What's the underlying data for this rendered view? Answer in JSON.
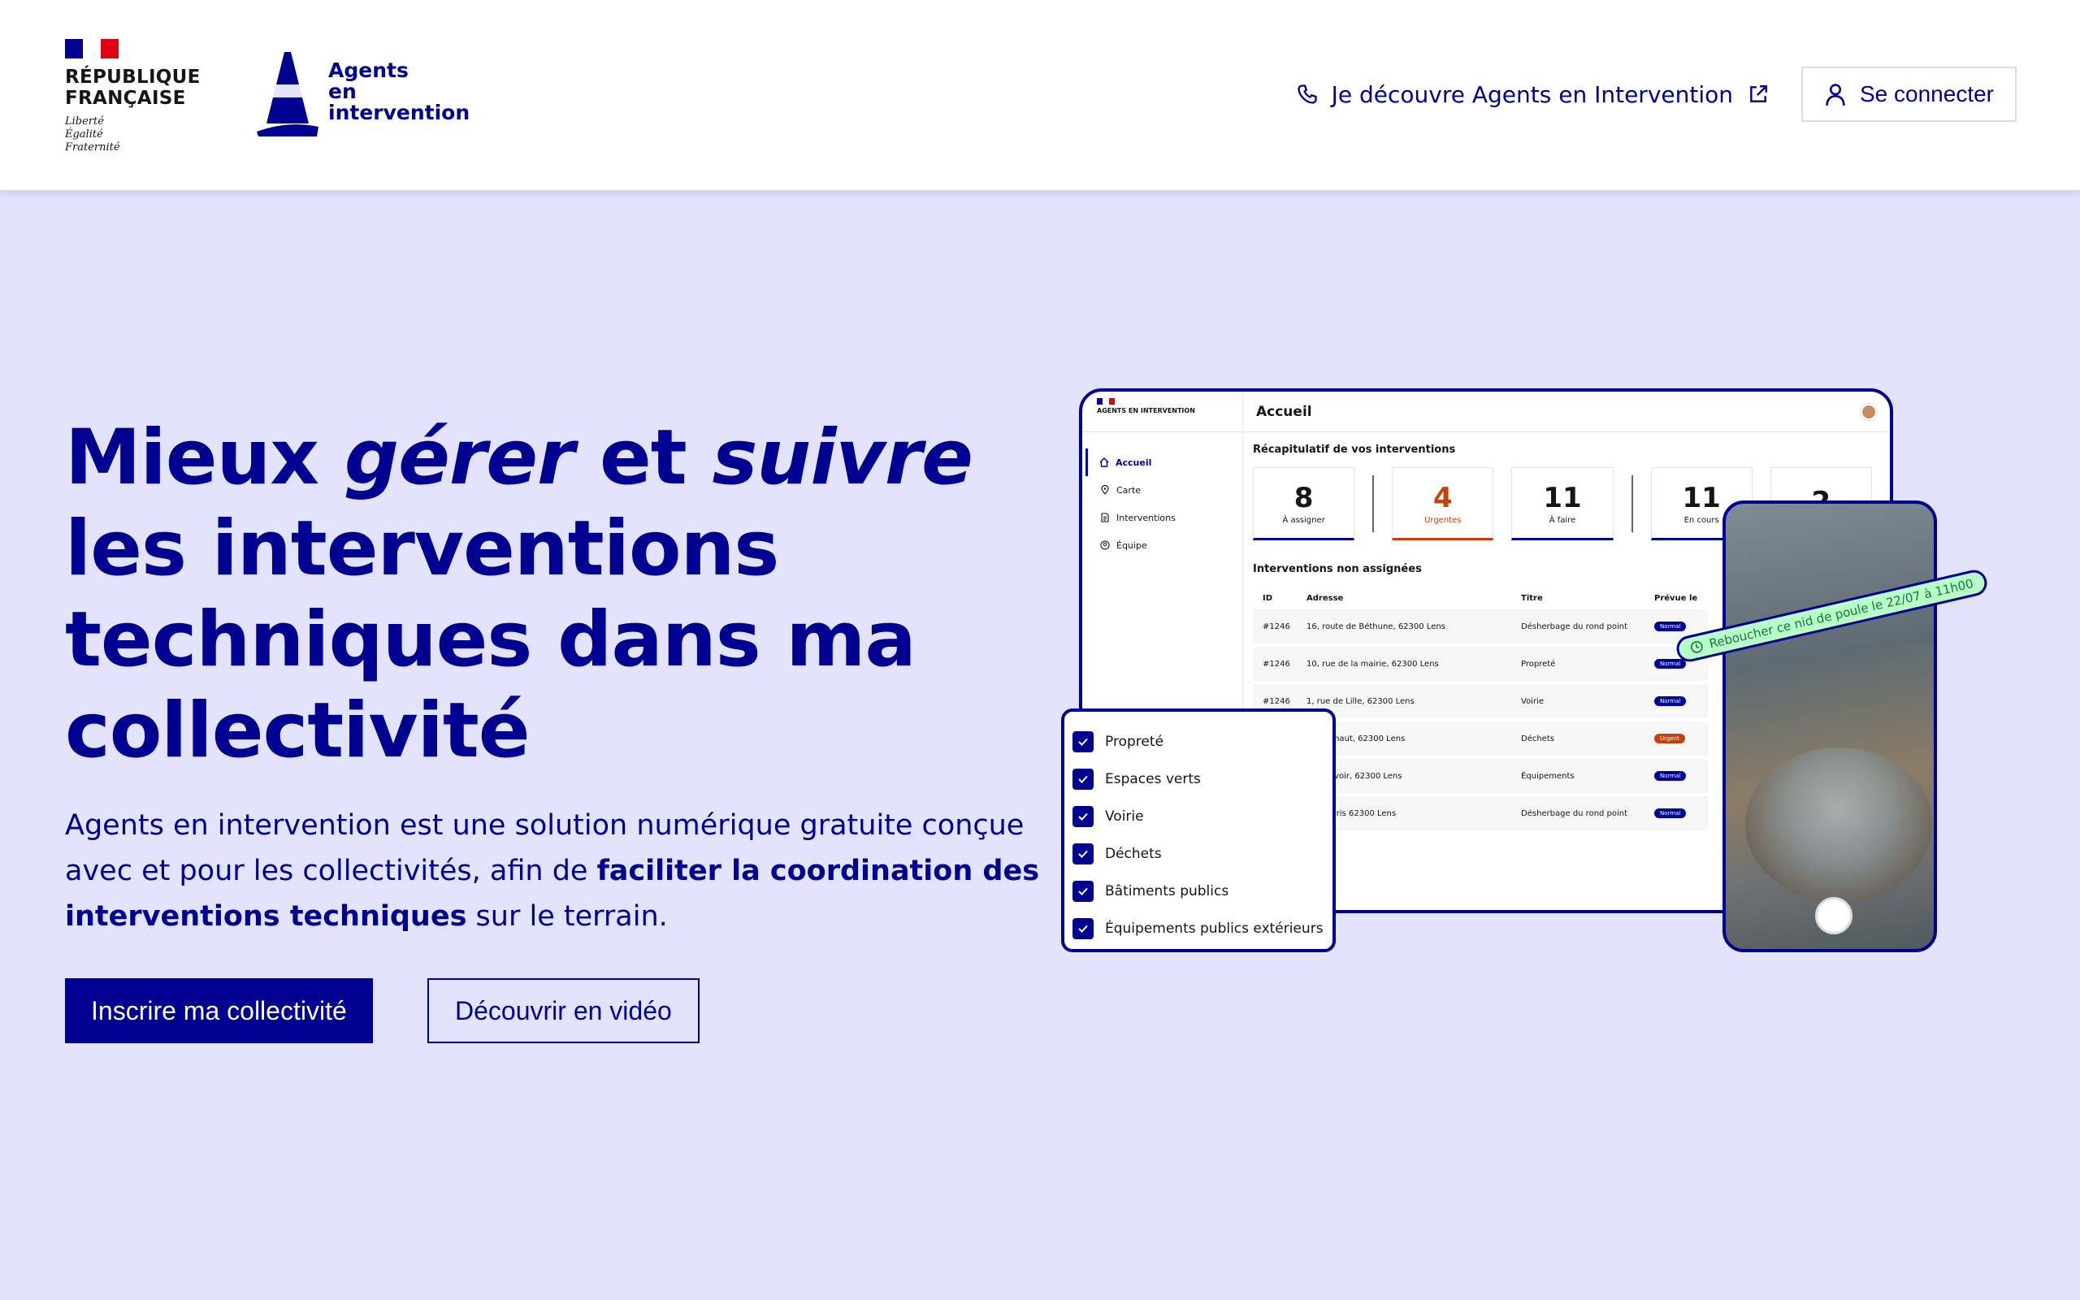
{
  "header": {
    "republic_line1": "RÉPUBLIQUE",
    "republic_line2": "FRANÇAISE",
    "motto": [
      "Liberté",
      "Égalité",
      "Fraternité"
    ],
    "brand_line1": "Agents",
    "brand_line2": "en",
    "brand_line3": "intervention",
    "discover_link": "Je découvre Agents en Intervention",
    "login_label": "Se connecter"
  },
  "hero": {
    "title_part1": "Mieux ",
    "title_em1": "gérer",
    "title_part2": " et ",
    "title_em2": "suivre",
    "title_part3": "les interventions techniques dans ma collectivité",
    "desc_part1": "Agents en intervention est une solution numérique gratuite conçue avec et pour les collectivités, afin de ",
    "desc_strong": "faciliter la coordination des interventions techniques",
    "desc_part2": " sur le terrain.",
    "primary_button": "Inscrire ma collectivité",
    "secondary_button": "Découvrir en vidéo"
  },
  "mockup": {
    "app_name": "AGENTS EN INTERVENTION",
    "menu": [
      "Accueil",
      "Carte",
      "Interventions",
      "Équipe"
    ],
    "page_title": "Accueil",
    "summary_title": "Récapitulatif de vos interventions",
    "cards": [
      {
        "num": "8",
        "label": "À assigner"
      },
      {
        "num": "4",
        "label": "Urgentes"
      },
      {
        "num": "11",
        "label": "À faire"
      },
      {
        "num": "11",
        "label": "En cours"
      },
      {
        "num": "2",
        "label": ""
      }
    ],
    "table_title": "Interventions non assignées",
    "columns": [
      "ID",
      "Adresse",
      "Titre",
      "Prévue le"
    ],
    "rows": [
      {
        "id": "#1246",
        "addr": "16, route de Béthune, 62300 Lens",
        "title": "Désherbage du rond point",
        "badge": "Normal"
      },
      {
        "id": "#1246",
        "addr": "10, rue de la mairie, 62300 Lens",
        "title": "Propreté",
        "badge": "Normal"
      },
      {
        "id": "#1246",
        "addr": "1, rue de Lille, 62300 Lens",
        "title": "Voirie",
        "badge": "Normal"
      },
      {
        "id": "",
        "addr": "e d'en haut, 62300 Lens",
        "title": "Déchets",
        "badge": "Urgent"
      },
      {
        "id": "",
        "addr": "e du lavoir, 62300 Lens",
        "title": "Équipements",
        "badge": "Normal"
      },
      {
        "id": "",
        "addr": "e de Paris 62300 Lens",
        "title": "Désherbage du rond point",
        "badge": "Normal"
      }
    ],
    "filters": [
      "Propreté",
      "Espaces verts",
      "Voirie",
      "Déchets",
      "Bâtiments publics",
      "Équipements publics extérieurs"
    ],
    "photo_tag": "Reboucher ce nid de poule le 22/07 à 11h00"
  },
  "colors": {
    "primary": "#000091",
    "background": "#e3e3fd",
    "urgent": "#c2410c",
    "tag_bg": "#b8fec9"
  }
}
